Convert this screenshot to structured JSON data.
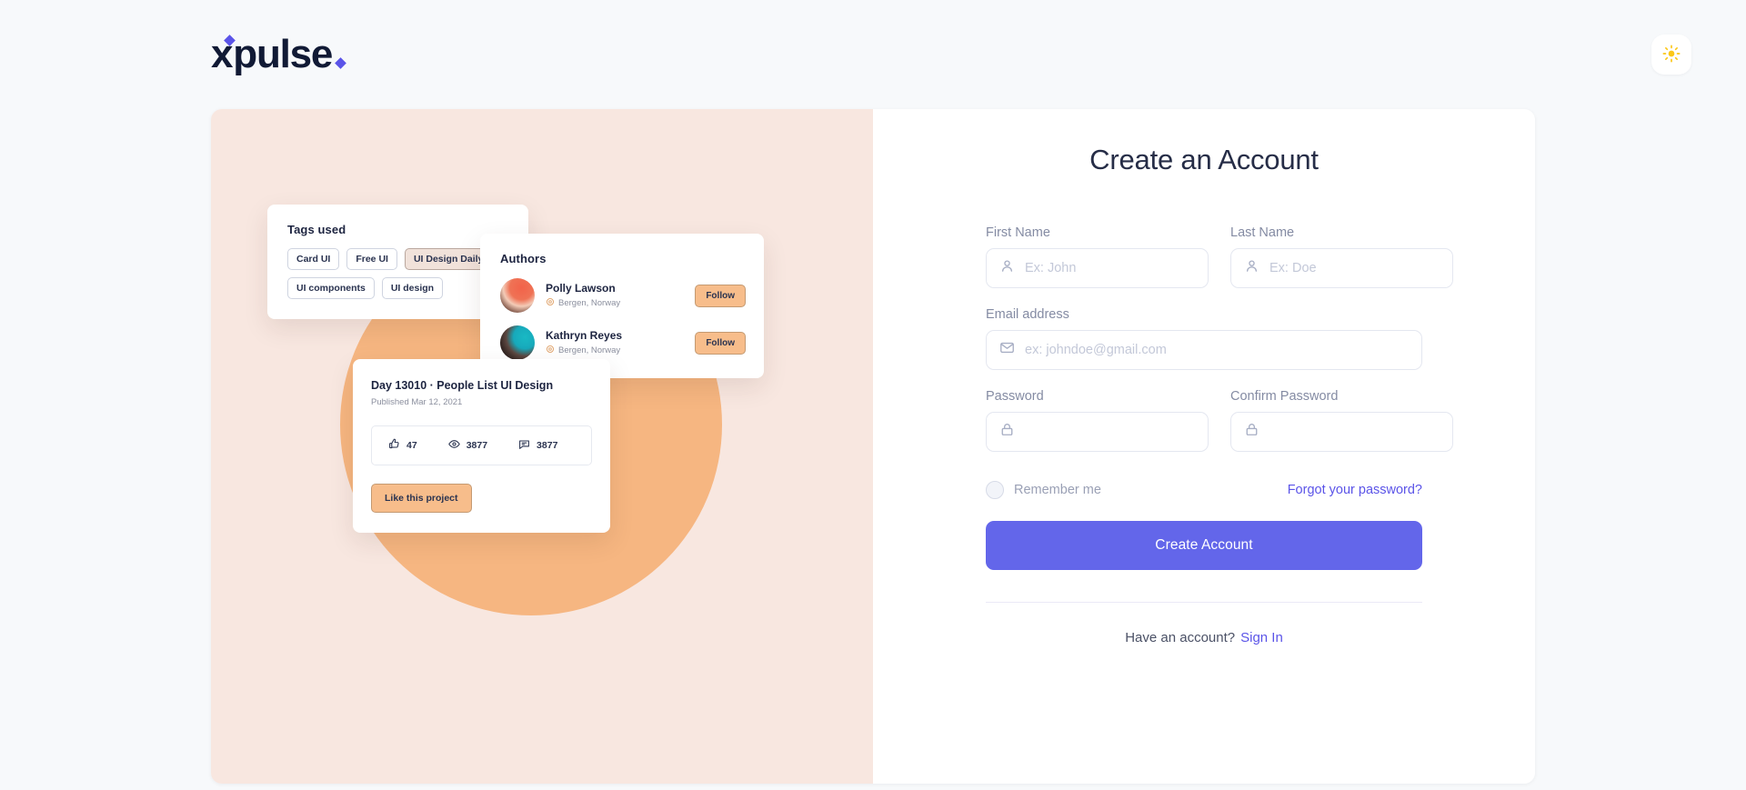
{
  "header": {
    "logo_x": "x",
    "logo_text": "pulse",
    "theme_toggle_icon": "sun-icon",
    "theme_toggle_label": "Toggle light mode"
  },
  "illustration": {
    "tags_card": {
      "title": "Tags used",
      "tags": [
        {
          "label": "Card UI",
          "active": false
        },
        {
          "label": "Free UI",
          "active": false
        },
        {
          "label": "UI Design Daily",
          "active": true
        },
        {
          "label": "UI components",
          "active": false
        },
        {
          "label": "UI design",
          "active": false
        }
      ]
    },
    "authors_card": {
      "title": "Authors",
      "authors": [
        {
          "name": "Polly Lawson",
          "location": "Bergen, Norway",
          "follow_label": "Follow"
        },
        {
          "name": "Kathryn Reyes",
          "location": "Bergen, Norway",
          "follow_label": "Follow"
        }
      ]
    },
    "project_card": {
      "title": "Day 13010 · People List UI Design",
      "published": "Published Mar 12, 2021",
      "stats": [
        {
          "icon": "thumbs-up-icon",
          "value": "47"
        },
        {
          "icon": "eye-icon",
          "value": "3877"
        },
        {
          "icon": "comment-icon",
          "value": "3877"
        }
      ],
      "like_label": "Like this project"
    }
  },
  "form": {
    "title": "Create an Account",
    "first_name": {
      "label": "First Name",
      "placeholder": "Ex: John",
      "value": "",
      "icon": "user-icon"
    },
    "last_name": {
      "label": "Last Name",
      "placeholder": "Ex: Doe",
      "value": "",
      "icon": "user-icon"
    },
    "email": {
      "label": "Email address",
      "placeholder": "ex: johndoe@gmail.com",
      "value": "",
      "icon": "mail-icon"
    },
    "password": {
      "label": "Password",
      "placeholder": "",
      "value": "",
      "icon": "lock-icon"
    },
    "confirm_password": {
      "label": "Confirm Password",
      "placeholder": "",
      "value": "",
      "icon": "lock-icon"
    },
    "remember_label": "Remember me",
    "remember_checked": false,
    "forgot_label": "Forgot your password?",
    "submit_label": "Create Account",
    "footer_text": "Have an account?",
    "signin_label": "Sign In"
  },
  "colors": {
    "page_background": "#f7f9fb",
    "panel_background": "#f8e7e0",
    "blob": "#f6b681",
    "accent": "#6366ea",
    "link": "#5b54e8",
    "logo": "#111a35",
    "sun": "#fbc718",
    "follow_button": "#f7bd8b"
  }
}
